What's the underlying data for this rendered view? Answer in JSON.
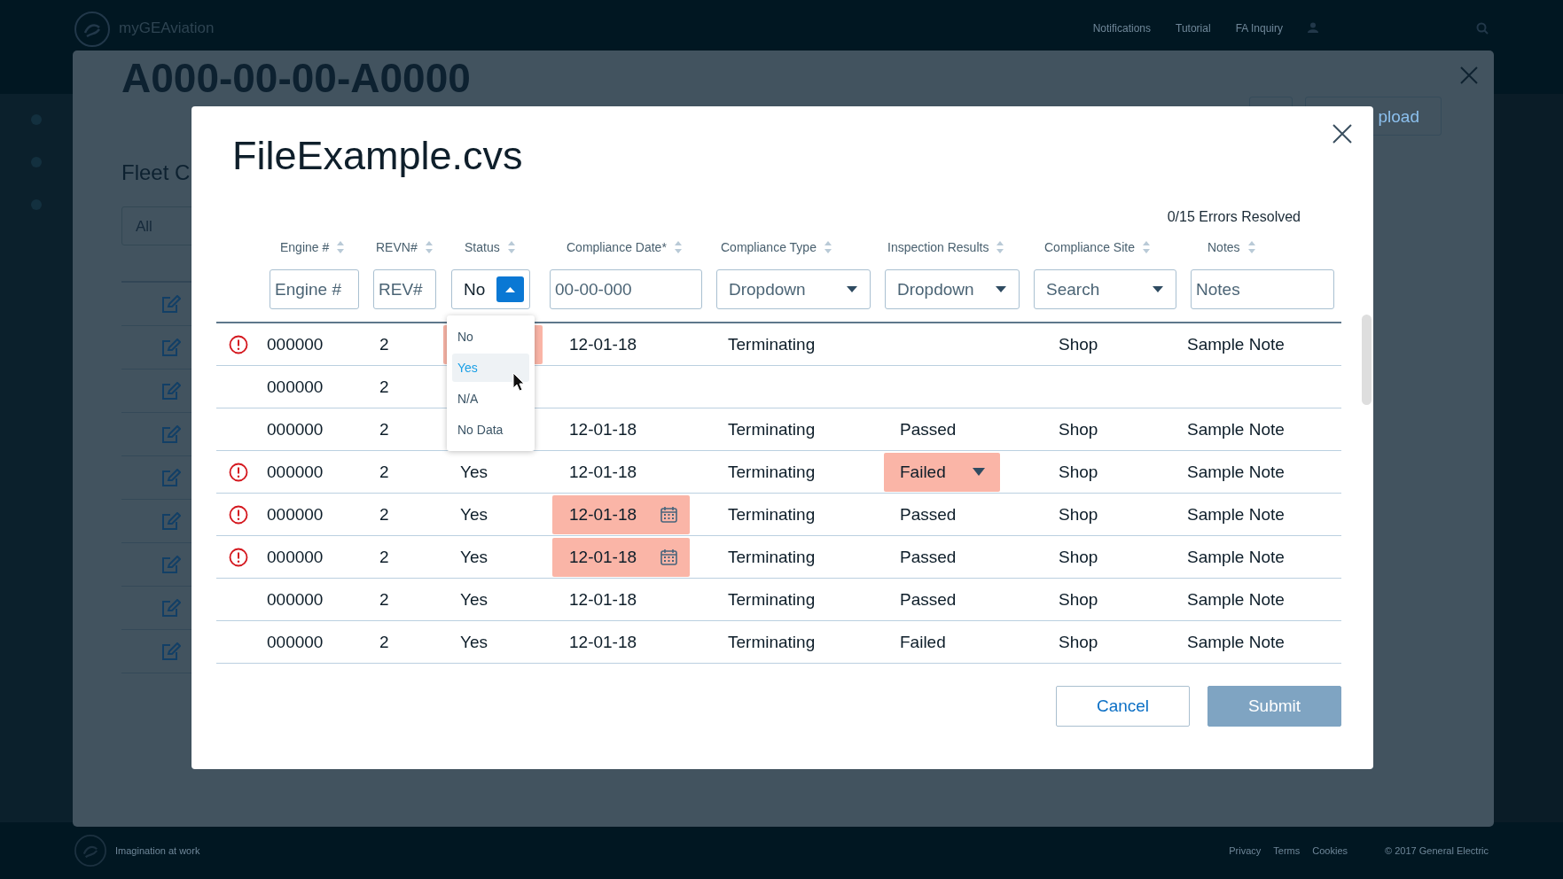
{
  "topbar": {
    "brand": "myGEAviation",
    "nav": [
      {
        "label": "Notifications"
      },
      {
        "label": "Tutorial"
      },
      {
        "label": "FA Inquiry"
      }
    ]
  },
  "background_page": {
    "title": "A000-00-00-A0000",
    "subtitle": "Fleet C",
    "filter": "All",
    "button": "pload"
  },
  "dialog": {
    "title": "FileExample.cvs",
    "errors_resolved": "0/15 Errors Resolved",
    "columns": [
      "Engine #",
      "REVN#",
      "Status",
      "Compliance Date*",
      "Compliance Type",
      "Inspection Results",
      "Compliance Site",
      "Notes"
    ],
    "filters": [
      {
        "kind": "input",
        "placeholder": "Engine #"
      },
      {
        "kind": "input",
        "placeholder": "REV#"
      },
      {
        "kind": "select",
        "value": "No",
        "expanded": true
      },
      {
        "kind": "input",
        "placeholder": "00-00-000"
      },
      {
        "kind": "dropdown",
        "placeholder": "Dropdown"
      },
      {
        "kind": "dropdown",
        "placeholder": "Dropdown"
      },
      {
        "kind": "dropdown",
        "placeholder": "Search"
      },
      {
        "kind": "input",
        "placeholder": "Notes"
      }
    ],
    "status_menu": {
      "options": [
        {
          "label": "No",
          "selected": false
        },
        {
          "label": "Yes",
          "selected": true
        },
        {
          "label": "N/A",
          "selected": false
        },
        {
          "label": "No Data",
          "selected": false
        }
      ]
    },
    "rows": [
      {
        "error": true,
        "engine": "000000",
        "revn": "2",
        "status": {
          "flagged": true
        },
        "date": {
          "text": "12-01-18",
          "flagged": false
        },
        "type": "Terminating",
        "inspection": {
          "flagged": false
        },
        "site": "Shop",
        "notes": "Sample Note"
      },
      {
        "error": false,
        "engine": "000000",
        "revn": "2"
      },
      {
        "error": false,
        "engine": "000000",
        "revn": "2",
        "date": {
          "text": "12-01-18",
          "flagged": false
        },
        "type": "Terminating",
        "inspection": {
          "text": "Passed",
          "flagged": false
        },
        "site": "Shop",
        "notes": "Sample Note"
      },
      {
        "error": true,
        "engine": "000000",
        "revn": "2",
        "status": {
          "text": "Yes",
          "flagged": false
        },
        "date": {
          "text": "12-01-18",
          "flagged": false
        },
        "type": "Terminating",
        "inspection": {
          "text": "Failed",
          "flagged": true
        },
        "site": "Shop",
        "notes": "Sample Note"
      },
      {
        "error": true,
        "engine": "000000",
        "revn": "2",
        "status": {
          "text": "Yes",
          "flagged": false
        },
        "date": {
          "text": "12-01-18",
          "flagged": true
        },
        "type": "Terminating",
        "inspection": {
          "text": "Passed",
          "flagged": false
        },
        "site": "Shop",
        "notes": "Sample Note"
      },
      {
        "error": true,
        "engine": "000000",
        "revn": "2",
        "status": {
          "text": "Yes",
          "flagged": false
        },
        "date": {
          "text": "12-01-18",
          "flagged": true
        },
        "type": "Terminating",
        "inspection": {
          "text": "Passed",
          "flagged": false
        },
        "site": "Shop",
        "notes": "Sample Note"
      },
      {
        "error": false,
        "engine": "000000",
        "revn": "2",
        "status": {
          "text": "Yes",
          "flagged": false
        },
        "date": {
          "text": "12-01-18",
          "flagged": false
        },
        "type": "Terminating",
        "inspection": {
          "text": "Passed",
          "flagged": false
        },
        "site": "Shop",
        "notes": "Sample Note"
      },
      {
        "error": false,
        "engine": "000000",
        "revn": "2",
        "status": {
          "text": "Yes",
          "flagged": false
        },
        "date": {
          "text": "12-01-18",
          "flagged": false
        },
        "type": "Terminating",
        "inspection": {
          "text": "Failed",
          "flagged": false
        },
        "site": "Shop",
        "notes": "Sample Note"
      }
    ],
    "buttons": [
      {
        "label": "Cancel",
        "disabled": false
      },
      {
        "label": "Submit",
        "disabled": true
      }
    ]
  },
  "footer": {
    "tagline": "Imagination at work",
    "links": [
      "Privacy",
      "Terms",
      "Cookies"
    ],
    "copyright": "© 2017 General Electric"
  }
}
